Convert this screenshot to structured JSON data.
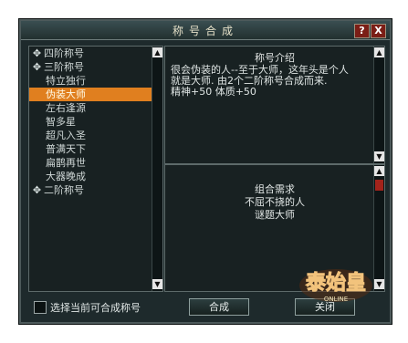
{
  "window": {
    "title": "称号合成"
  },
  "titlebar": {
    "help": "?",
    "close": "X"
  },
  "list": {
    "items": [
      {
        "label": "四阶称号",
        "kind": "group"
      },
      {
        "label": "三阶称号",
        "kind": "group"
      },
      {
        "label": "特立独行",
        "kind": "child"
      },
      {
        "label": "伪装大师",
        "kind": "child",
        "selected": true
      },
      {
        "label": "左右逢源",
        "kind": "child"
      },
      {
        "label": "智多星",
        "kind": "child"
      },
      {
        "label": "超凡入圣",
        "kind": "child"
      },
      {
        "label": "普满天下",
        "kind": "child"
      },
      {
        "label": "扁鹊再世",
        "kind": "child"
      },
      {
        "label": "大器晚成",
        "kind": "child"
      },
      {
        "label": "二阶称号",
        "kind": "group"
      }
    ]
  },
  "intro": {
    "title": "称号介绍",
    "line1": "很会伪装的人--至于大师，这年头是个人",
    "line2": "就是大师. 由2个二阶称号合成而来.",
    "line3": "精神+50  体质+50"
  },
  "need": {
    "title": "组合需求",
    "line1": "不屈不挠的人",
    "line2": "谜题大师"
  },
  "bottom": {
    "checkbox_label": "选择当前可合成称号",
    "combine": "合成",
    "close": "关闭"
  },
  "logo": {
    "text": "泰始皇",
    "sub": "ONLINE"
  }
}
